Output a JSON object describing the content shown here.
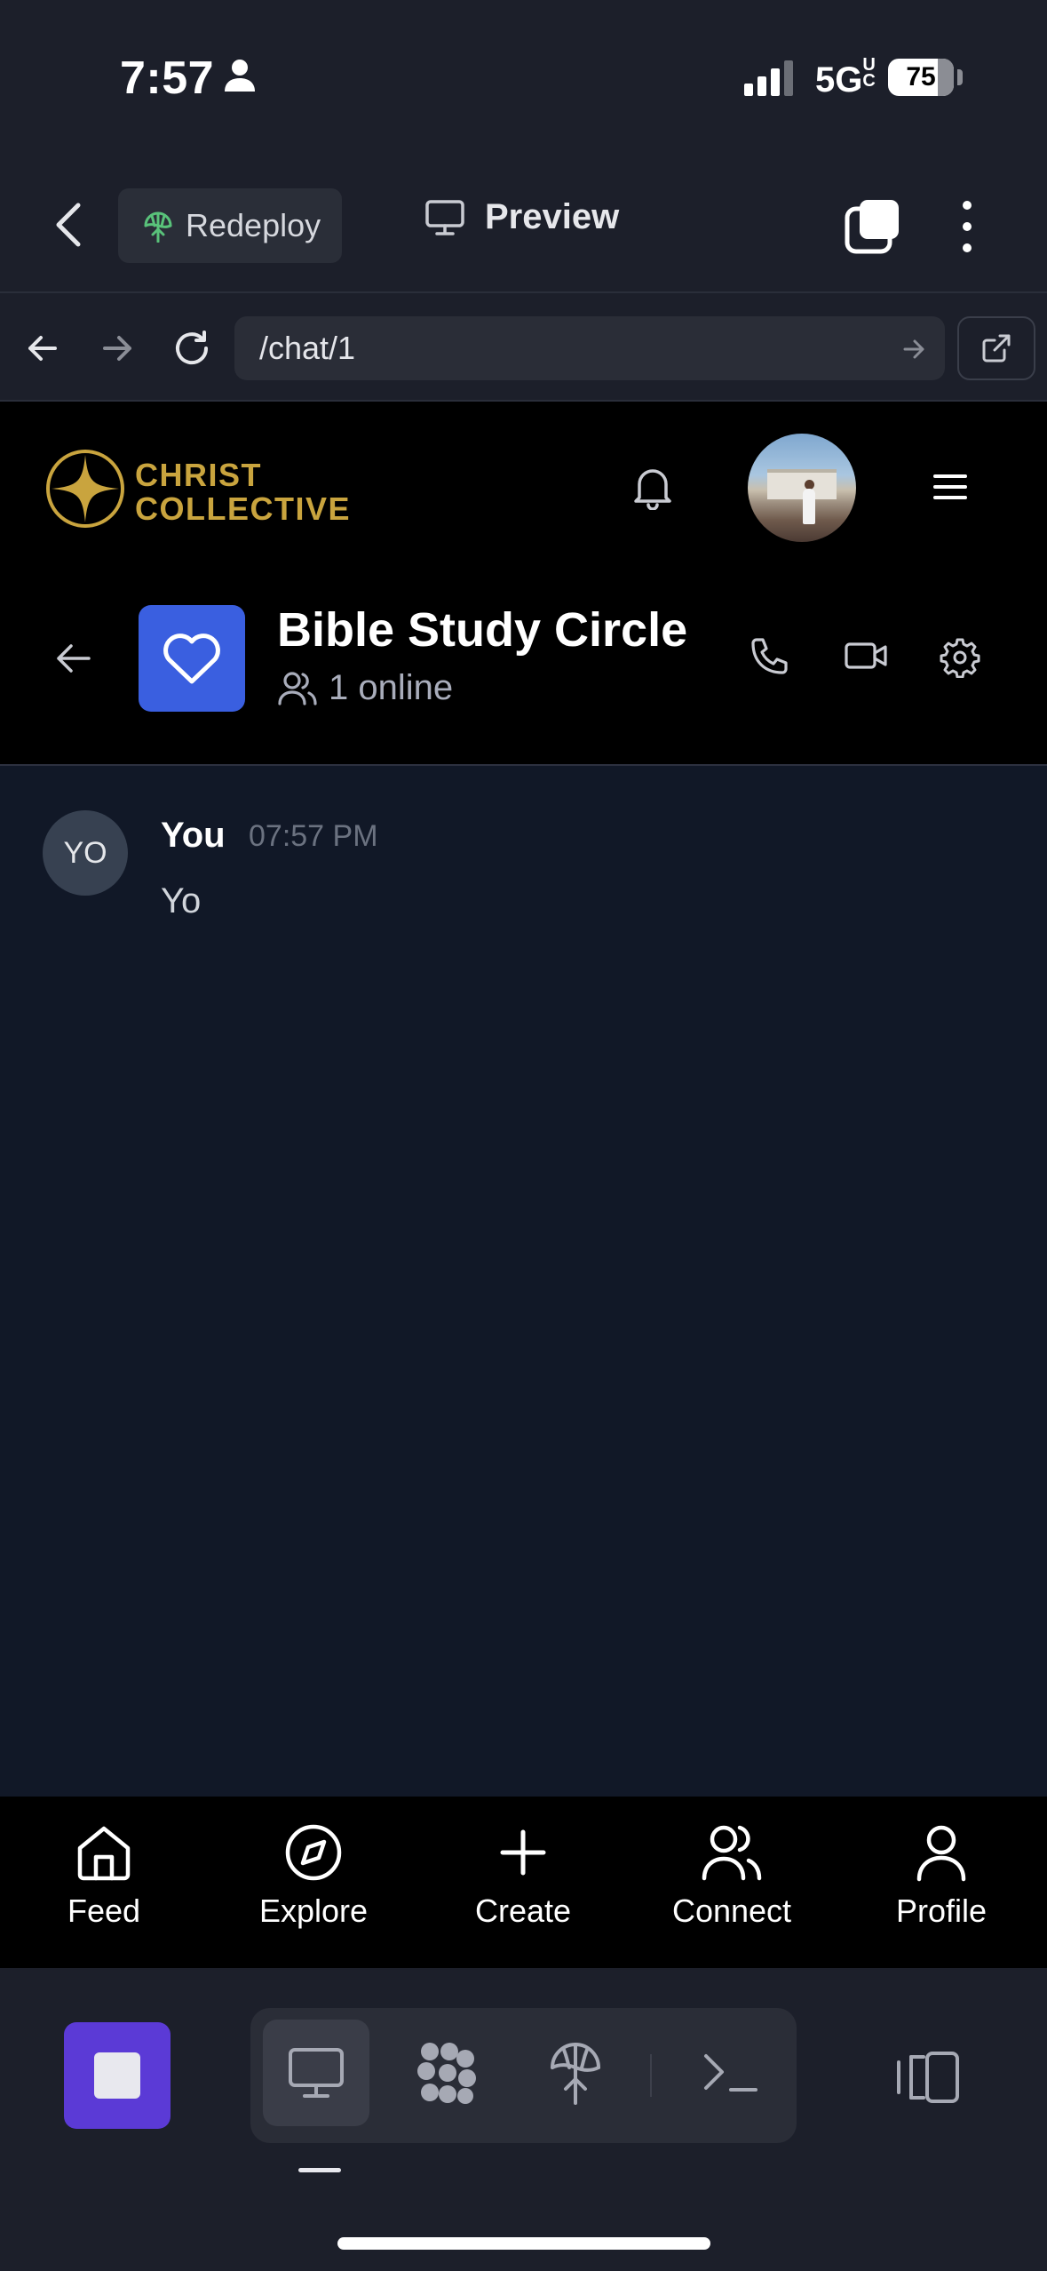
{
  "status_bar": {
    "time": "7:57",
    "network": "5G",
    "network_sub": "UC",
    "battery": "75"
  },
  "toolbar": {
    "redeploy_label": "Redeploy",
    "preview_label": "Preview"
  },
  "url_bar": {
    "url": "/chat/1"
  },
  "site_header": {
    "logo_line1": "CHRIST",
    "logo_line2": "COLLECTIVE",
    "accent_color": "#c9a43e"
  },
  "chat_header": {
    "title": "Bible Study Circle",
    "online": "1 online",
    "icon_color": "#3a5fe0"
  },
  "messages": [
    {
      "avatar": "YO",
      "author": "You",
      "time": "07:57 PM",
      "text": "Yo"
    }
  ],
  "tabs": [
    {
      "label": "Feed",
      "icon": "home-icon"
    },
    {
      "label": "Explore",
      "icon": "compass-icon"
    },
    {
      "label": "Create",
      "icon": "plus-icon"
    },
    {
      "label": "Connect",
      "icon": "users-icon"
    },
    {
      "label": "Profile",
      "icon": "user-icon"
    }
  ],
  "dev_toolbar": {
    "stop_color": "#5b3ad6",
    "items": [
      "monitor-icon",
      "grid-icon",
      "deploy-icon",
      "terminal-icon"
    ]
  }
}
